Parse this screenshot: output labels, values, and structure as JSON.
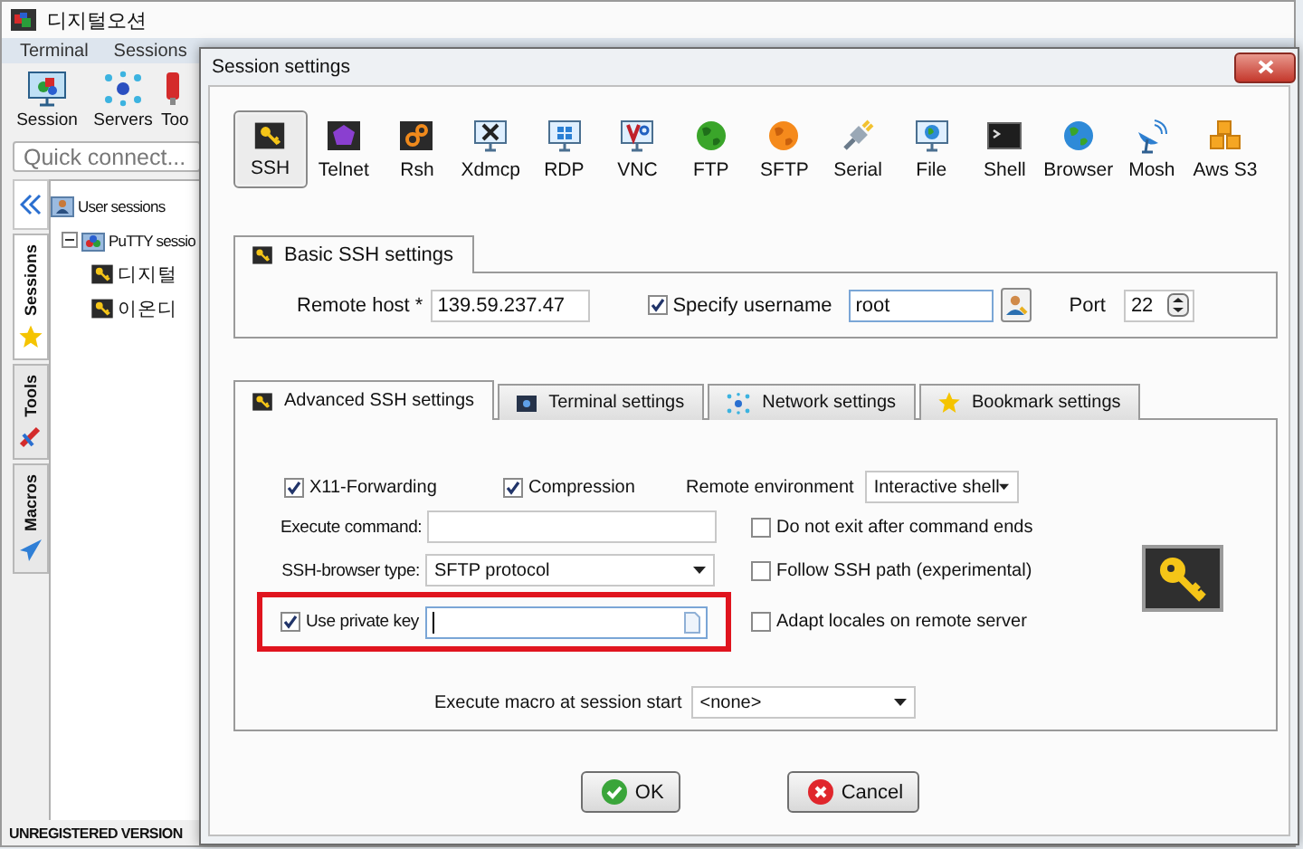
{
  "main_window": {
    "title": "디지털오션",
    "menu": [
      "Terminal",
      "Sessions"
    ],
    "toolbar": [
      {
        "label": "Session"
      },
      {
        "label": "Servers"
      },
      {
        "label": "Too"
      }
    ],
    "quick_connect": {
      "placeholder": "Quick connect..."
    },
    "side_tabs": [
      {
        "label": "Sessions",
        "selected": true
      },
      {
        "label": "Tools",
        "selected": false
      },
      {
        "label": "Macros",
        "selected": false
      }
    ],
    "tree": [
      {
        "label": "User sessions",
        "children": [
          {
            "label": "PuTTY sessio",
            "expanded": true,
            "children": [
              {
                "label": "디지털"
              },
              {
                "label": "이온디"
              }
            ]
          }
        ]
      }
    ],
    "status": "UNREGISTERED VERSION"
  },
  "dialog": {
    "title": "Session settings",
    "session_types": [
      {
        "label": "SSH",
        "selected": true
      },
      {
        "label": "Telnet",
        "selected": false
      },
      {
        "label": "Rsh",
        "selected": false
      },
      {
        "label": "Xdmcp",
        "selected": false
      },
      {
        "label": "RDP",
        "selected": false
      },
      {
        "label": "VNC",
        "selected": false
      },
      {
        "label": "FTP",
        "selected": false
      },
      {
        "label": "SFTP",
        "selected": false
      },
      {
        "label": "Serial",
        "selected": false
      },
      {
        "label": "File",
        "selected": false
      },
      {
        "label": "Shell",
        "selected": false
      },
      {
        "label": "Browser",
        "selected": false
      },
      {
        "label": "Mosh",
        "selected": false
      },
      {
        "label": "Aws S3",
        "selected": false
      }
    ],
    "basic": {
      "title": "Basic SSH settings",
      "remote_host": {
        "label": "Remote host *",
        "value": "139.59.237.47"
      },
      "specify_username": {
        "label": "Specify username",
        "checked": true,
        "value": "root"
      },
      "port": {
        "label": "Port",
        "value": "22"
      }
    },
    "advanced": {
      "tabs": [
        {
          "label": "Advanced SSH settings",
          "selected": true
        },
        {
          "label": "Terminal settings",
          "selected": false
        },
        {
          "label": "Network settings",
          "selected": false
        },
        {
          "label": "Bookmark settings",
          "selected": false
        }
      ],
      "x11_forwarding": {
        "label": "X11-Forwarding",
        "checked": true
      },
      "compression": {
        "label": "Compression",
        "checked": true
      },
      "remote_environment": {
        "label": "Remote environment",
        "value": "Interactive shell"
      },
      "execute_command": {
        "label": "Execute command:"
      },
      "do_not_exit": {
        "label": "Do not exit after command ends",
        "checked": false
      },
      "ssh_browser_type": {
        "label": "SSH-browser type:",
        "value": "SFTP protocol"
      },
      "follow_ssh_path": {
        "label": "Follow SSH path (experimental)",
        "checked": false
      },
      "use_private_key": {
        "label": "Use private key",
        "checked": true,
        "highlighted": true,
        "focused": true
      },
      "adapt_locales": {
        "label": "Adapt locales on remote server",
        "checked": false
      },
      "execute_macro": {
        "label": "Execute macro at session start",
        "value": "<none>"
      }
    },
    "buttons": [
      {
        "label": "OK",
        "kind": "ok"
      },
      {
        "label": "Cancel",
        "kind": "cancel"
      }
    ]
  }
}
